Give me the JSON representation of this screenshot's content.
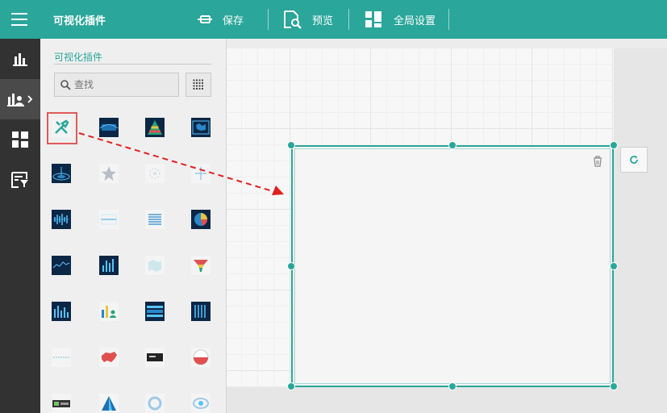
{
  "app": {
    "title": "可视化插件"
  },
  "toolbar": {
    "save_label": "保存",
    "preview_label": "预览",
    "global_settings_label": "全局设置"
  },
  "panel": {
    "title": "可视化插件",
    "search_placeholder": "查找"
  },
  "colors": {
    "accent": "#2aa69a",
    "rail": "#323232",
    "highlight": "#e05a5a",
    "arrow": "#e02020"
  },
  "icons": {
    "menu": "hamburger-icon",
    "save": "save-pin-icon",
    "preview": "preview-magnifier-icon",
    "settings": "layout-grid-icon",
    "search": "search-icon",
    "view_toggle": "grid-view-icon",
    "delete": "trash-icon",
    "refresh": "refresh-icon"
  },
  "rail_items": [
    {
      "name": "rail-charts",
      "icon": "bar-chart-icon",
      "active": false
    },
    {
      "name": "rail-plugins",
      "icon": "plugin-user-chart-icon",
      "active": true
    },
    {
      "name": "rail-dashboard",
      "icon": "dashboard-tiles-icon",
      "active": false
    },
    {
      "name": "rail-filter",
      "icon": "filter-list-icon",
      "active": false
    }
  ],
  "plugins": [
    {
      "name": "tool-plugin",
      "theme": "light",
      "icon": "wrench-tools-icon"
    },
    {
      "name": "holo-screen-plugin",
      "theme": "dark",
      "icon": "holo-screen-icon"
    },
    {
      "name": "pyramid-plugin",
      "theme": "dark",
      "icon": "pyramid-icon"
    },
    {
      "name": "map-panel-plugin",
      "theme": "dark",
      "icon": "map-panel-icon"
    },
    {
      "name": "ripple-plugin",
      "theme": "dark",
      "icon": "ripple-icon"
    },
    {
      "name": "star-plugin",
      "theme": "light",
      "icon": "star-icon"
    },
    {
      "name": "sparkle-plugin",
      "theme": "light",
      "icon": "sparkle-icon"
    },
    {
      "name": "cross-plugin",
      "theme": "light",
      "icon": "cross-icon"
    },
    {
      "name": "waveform-plugin",
      "theme": "dark",
      "icon": "waveform-icon"
    },
    {
      "name": "divider-plugin",
      "theme": "light",
      "icon": "divider-icon"
    },
    {
      "name": "list-plugin",
      "theme": "light",
      "icon": "list-lines-icon"
    },
    {
      "name": "pie-plugin",
      "theme": "dark",
      "icon": "pie-chart-icon"
    },
    {
      "name": "line-wave-plugin",
      "theme": "dark",
      "icon": "line-wave-icon"
    },
    {
      "name": "vbar-plugin",
      "theme": "dark",
      "icon": "vertical-bars-icon"
    },
    {
      "name": "map-light-plugin",
      "theme": "light",
      "icon": "map-light-icon"
    },
    {
      "name": "funnel-plugin",
      "theme": "light",
      "icon": "funnel-icon"
    },
    {
      "name": "bar-series-plugin",
      "theme": "dark",
      "icon": "bar-series-icon"
    },
    {
      "name": "bar-people-plugin",
      "theme": "light",
      "icon": "bar-people-icon"
    },
    {
      "name": "hbar-plugin",
      "theme": "dark",
      "icon": "horizontal-bars-icon"
    },
    {
      "name": "column-grid-plugin",
      "theme": "dark",
      "icon": "column-grid-icon"
    },
    {
      "name": "dotted-line-plugin",
      "theme": "light",
      "icon": "dotted-line-icon"
    },
    {
      "name": "china-map-plugin",
      "theme": "light",
      "icon": "china-map-icon"
    },
    {
      "name": "card-plugin",
      "theme": "light",
      "icon": "card-icon"
    },
    {
      "name": "gauge-plugin",
      "theme": "light",
      "icon": "half-gauge-icon"
    },
    {
      "name": "panel-dark-plugin",
      "theme": "light",
      "icon": "dark-panel-icon"
    },
    {
      "name": "peak-plugin",
      "theme": "light",
      "icon": "peak-icon"
    },
    {
      "name": "ring-plugin",
      "theme": "light",
      "icon": "ring-icon"
    },
    {
      "name": "orbit-plugin",
      "theme": "light",
      "icon": "orbit-icon"
    }
  ]
}
